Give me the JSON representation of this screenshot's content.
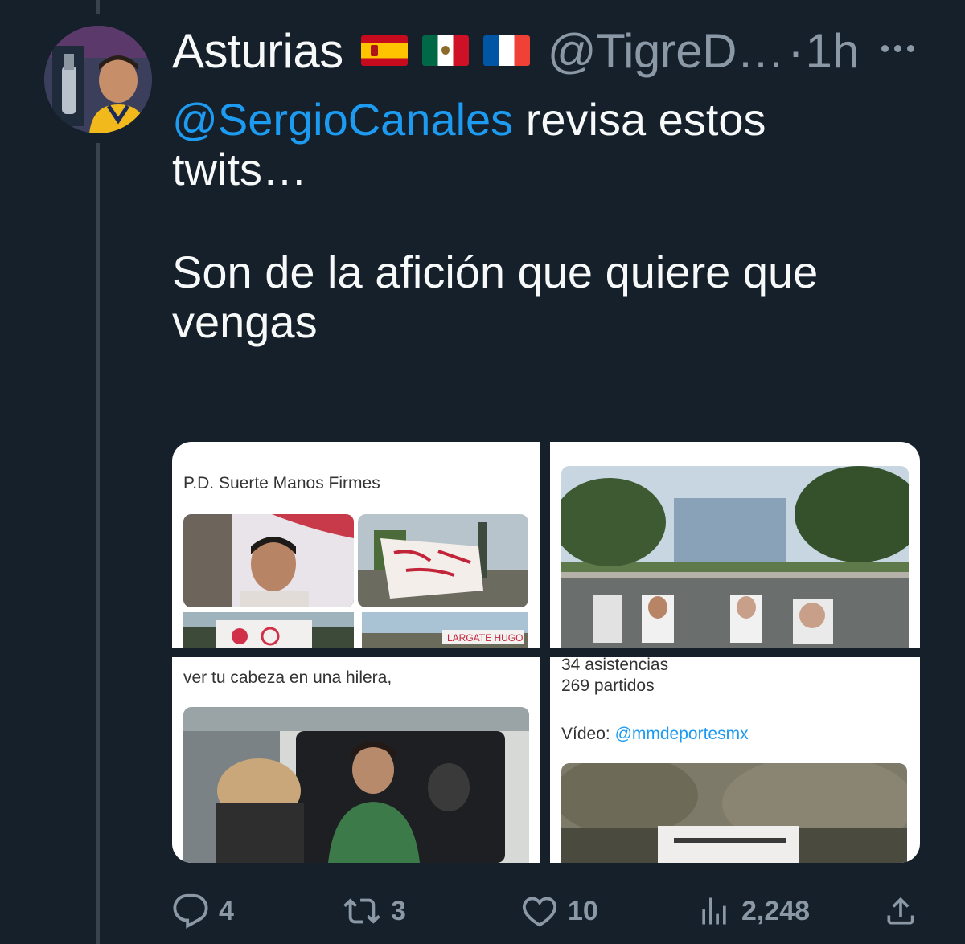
{
  "tweet": {
    "display_name": "Asturias",
    "handle": "@TigreD…",
    "separator": "·",
    "time": "1h",
    "flags": [
      "spain-flag",
      "mexico-flag",
      "france-flag"
    ],
    "text_mention": "@SergioCanales",
    "text_line1_rest": " revisa estos",
    "text_line2": "twits…",
    "text_line4": "Son de la afición que quiere que",
    "text_line5": "vengas"
  },
  "media": {
    "top_left_caption": "P.D. Suerte Manos Firmes",
    "bottom_left_caption": "ver tu cabeza en una hilera,",
    "bottom_right_line1": "34 asistencias",
    "bottom_right_line2": "269 partidos",
    "bottom_right_video_label": "Vídeo: ",
    "bottom_right_video_link": "@mmdeportesmx"
  },
  "actions": {
    "replies": "4",
    "retweets": "3",
    "likes": "10",
    "views": "2,248"
  },
  "colors": {
    "background": "#15202b",
    "accent": "#1d9bf0",
    "muted": "#8b98a5",
    "text": "#f7f9f9"
  }
}
